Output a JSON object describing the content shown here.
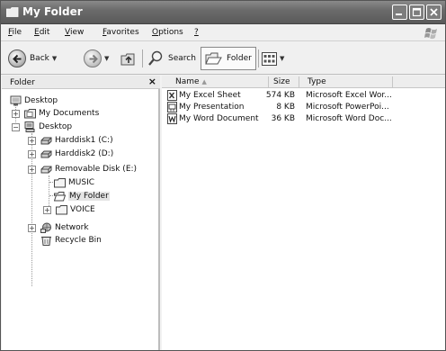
{
  "window": {
    "title": "My Folder"
  },
  "menu": [
    {
      "prefix": "",
      "accel": "F",
      "rest": "ile"
    },
    {
      "prefix": "",
      "accel": "E",
      "rest": "dit"
    },
    {
      "prefix": "",
      "accel": "V",
      "rest": "iew"
    },
    {
      "prefix": "",
      "accel": "F",
      "rest": "avorites"
    },
    {
      "prefix": "",
      "accel": "O",
      "rest": "ptions"
    },
    {
      "prefix": "",
      "accel": "?",
      "rest": ""
    }
  ],
  "toolbar": {
    "back_label": "Back",
    "search_label": "Search",
    "folder_label": "Folder"
  },
  "folder_pane": {
    "header": "Folder",
    "close_glyph": "×",
    "tree": [
      {
        "label": "Desktop",
        "expander": "",
        "icon": "desktop-icon"
      },
      {
        "label": "My Documents",
        "expander": "+",
        "icon": "my-documents-icon"
      },
      {
        "label": "Desktop",
        "expander": "−",
        "icon": "computer-icon"
      },
      {
        "label": "Harddisk1 (C:)",
        "expander": "+",
        "icon": "harddisk-icon"
      },
      {
        "label": "Harddisk2 (D:)",
        "expander": "+",
        "icon": "harddisk-icon"
      },
      {
        "label": "Removable Disk (E:)",
        "expander": "+",
        "icon": "removable-disk-icon"
      },
      {
        "label": "MUSIC",
        "expander": "",
        "icon": "folder-icon"
      },
      {
        "label": "My Folder",
        "expander": "",
        "icon": "open-folder-icon"
      },
      {
        "label": "VOICE",
        "expander": "+",
        "icon": "folder-icon"
      },
      {
        "label": "Network",
        "expander": "+",
        "icon": "network-icon"
      },
      {
        "label": "Recycle Bin",
        "expander": "",
        "icon": "recycle-bin-icon"
      }
    ]
  },
  "file_list": {
    "columns": {
      "name": "Name",
      "size": "Size",
      "type": "Type"
    },
    "rows": [
      {
        "name": "My Excel Sheet",
        "size": "574 KB",
        "type": "Microsoft Excel Wor...",
        "icon": "excel-file-icon"
      },
      {
        "name": "My Presentation",
        "size": "8 KB",
        "type": "Microsoft PowerPoi...",
        "icon": "powerpoint-file-icon"
      },
      {
        "name": "My Word Document",
        "size": "36 KB",
        "type": "Microsoft Word Doc...",
        "icon": "word-file-icon"
      }
    ]
  }
}
